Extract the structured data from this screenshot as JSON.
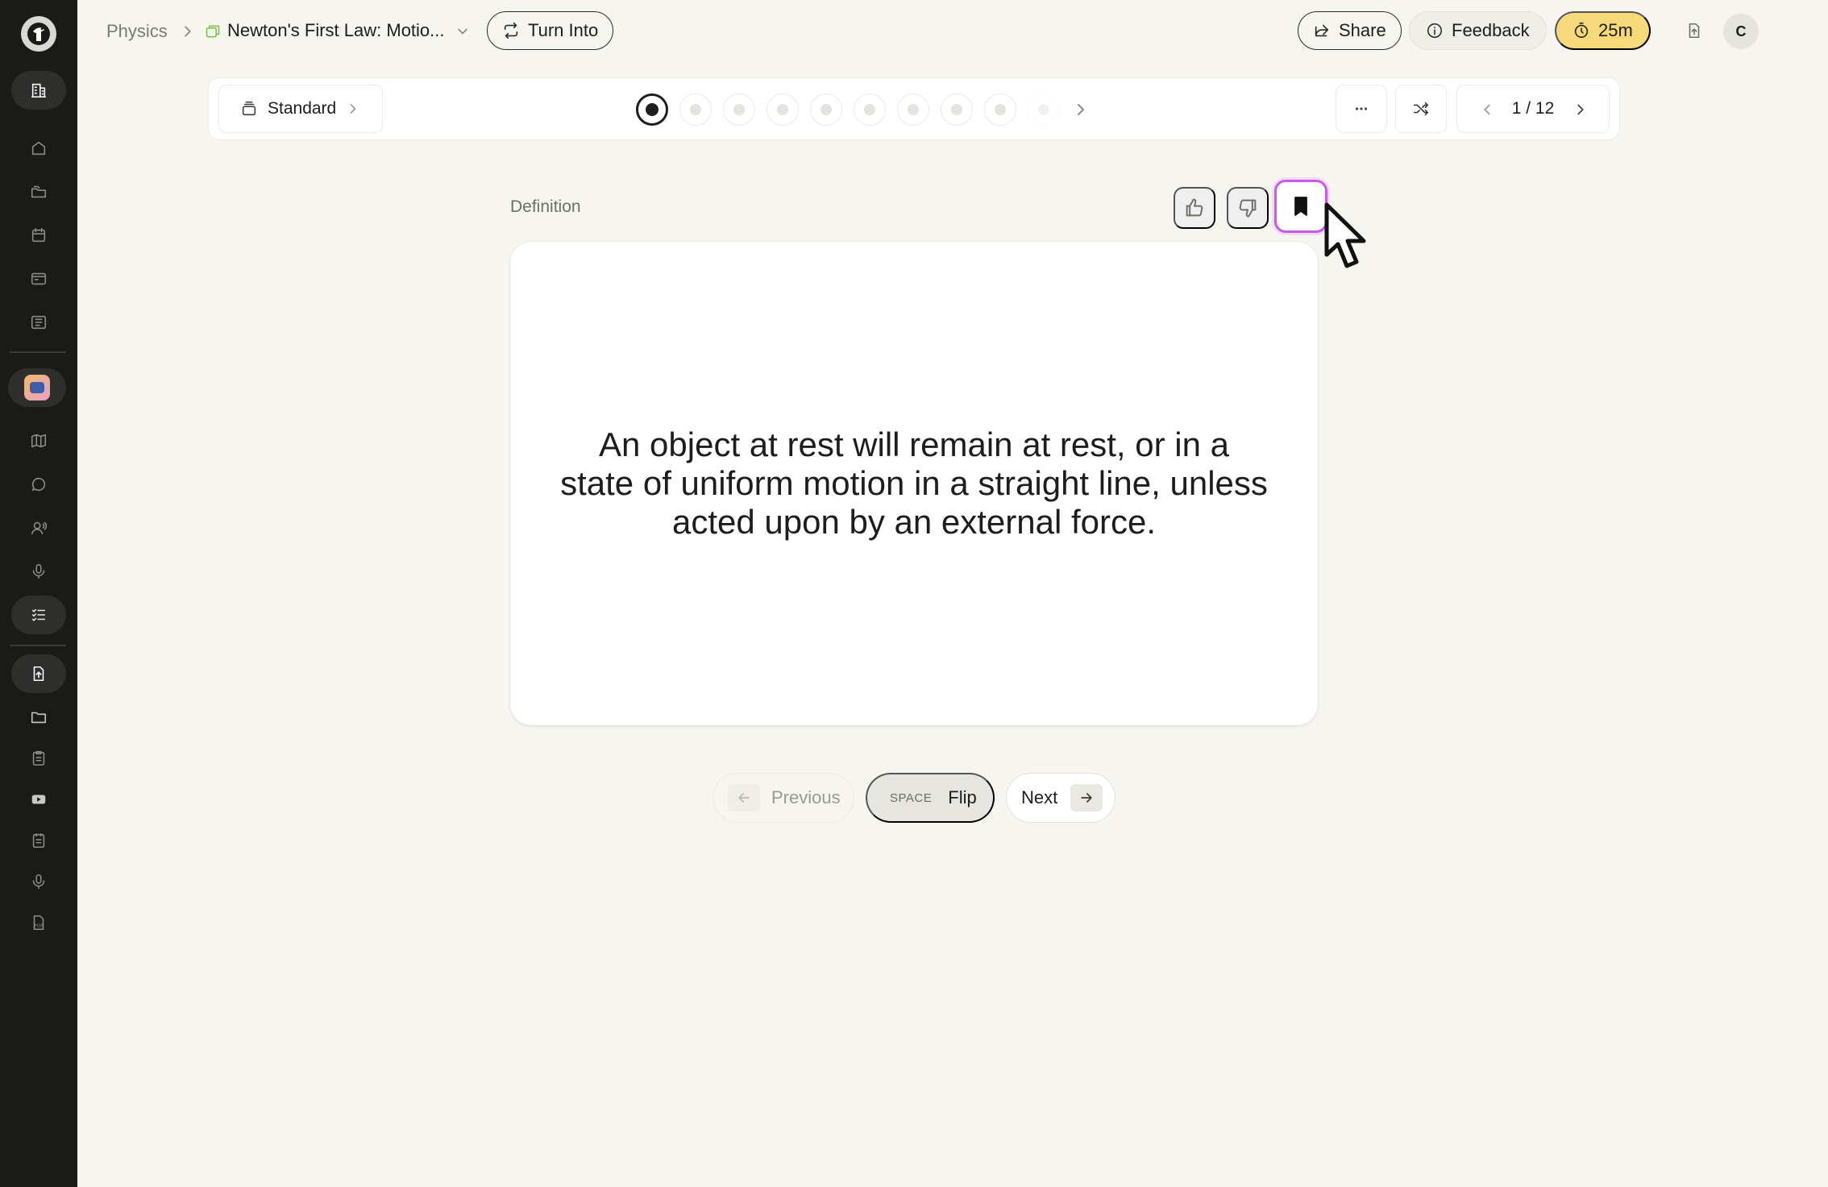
{
  "sidebar": {
    "items": [
      {
        "icon": "building-icon"
      },
      {
        "icon": "home-icon"
      },
      {
        "icon": "folders-icon"
      },
      {
        "icon": "calendar-icon"
      },
      {
        "icon": "browser-icon"
      },
      {
        "icon": "library-icon"
      },
      {
        "icon": "app-chip-icon"
      },
      {
        "icon": "map-icon"
      },
      {
        "icon": "chat-icon"
      },
      {
        "icon": "tutor-icon"
      },
      {
        "icon": "mic-icon"
      },
      {
        "icon": "checklist-icon"
      },
      {
        "icon": "upload-file-icon"
      },
      {
        "icon": "folder-icon"
      },
      {
        "icon": "clipboard-icon"
      },
      {
        "icon": "youtube-icon"
      },
      {
        "icon": "notes-icon"
      },
      {
        "icon": "mic-small-icon"
      },
      {
        "icon": "pdf-icon"
      }
    ]
  },
  "breadcrumb": {
    "root": "Physics",
    "title": "Newton's First Law: Motio..."
  },
  "header": {
    "turn_into": "Turn Into",
    "share": "Share",
    "feedback": "Feedback",
    "timer": "25m",
    "avatar": "C"
  },
  "controls": {
    "mode": "Standard",
    "dots_total_visible": 10,
    "active_dot": 1,
    "pager": "1 / 12"
  },
  "card": {
    "label": "Definition",
    "text": "An object at rest will remain at rest, or in a state of uniform motion in a straight line, unless acted upon by an external force.",
    "bookmarked": true
  },
  "footer": {
    "previous": "Previous",
    "space_key": "SPACE",
    "flip": "Flip",
    "next": "Next"
  },
  "colors": {
    "background": "#f6f5ef",
    "sidebar": "#1a1a19",
    "timer": "#f6d978",
    "bookmark_focus": "#c55be8",
    "breadcrumb_icon": "#7bbf3a"
  }
}
